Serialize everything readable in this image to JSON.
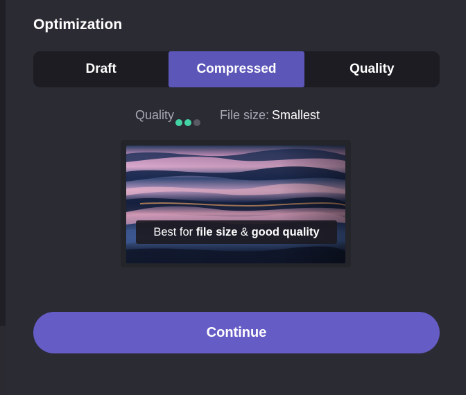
{
  "section": {
    "title": "Optimization"
  },
  "modes": [
    {
      "label": "Draft",
      "active": false
    },
    {
      "label": "Compressed",
      "active": true
    },
    {
      "label": "Quality",
      "active": false
    }
  ],
  "info": {
    "quality_label": "Quality",
    "quality_level": 2,
    "quality_max": 3,
    "filesize_label": "File size:",
    "filesize_value": "Smallest"
  },
  "preview": {
    "caption_prefix": "Best for",
    "caption_bold1": "file size",
    "caption_amp": "&",
    "caption_bold2": "good quality"
  },
  "actions": {
    "continue_label": "Continue"
  },
  "colors": {
    "background": "#2b2b34",
    "accent": "#5c56b8",
    "button": "#665cc6",
    "dot_on": "#44d3a4",
    "dot_off": "#595964"
  }
}
